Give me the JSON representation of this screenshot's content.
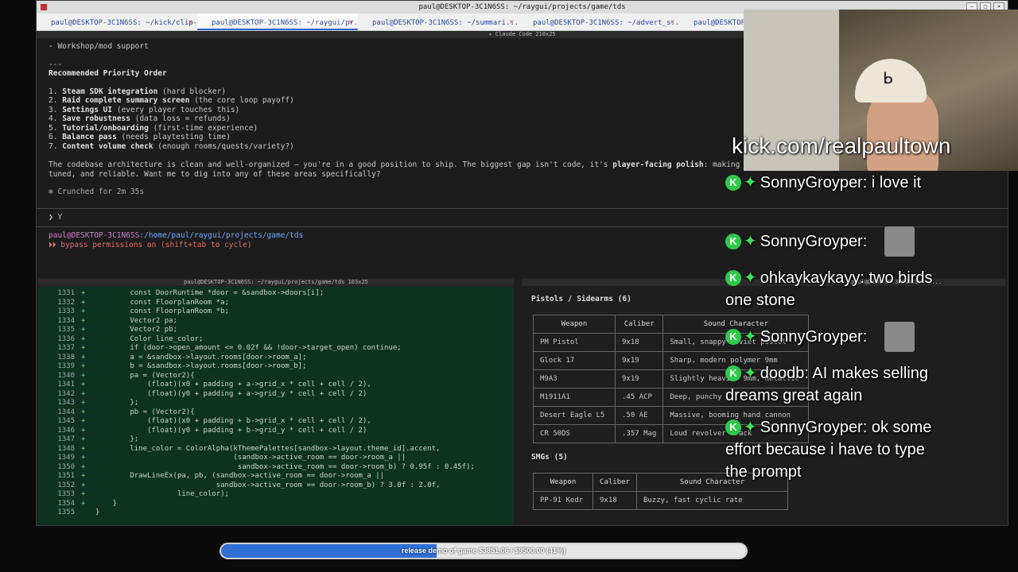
{
  "window": {
    "title": "paul@DESKTOP-3C1N6SS: ~/raygui/projects/game/tds",
    "tabs": [
      {
        "label": "paul@DESKTOP-3C1N6SS: ~/kick/clip-..."
      },
      {
        "label": "paul@DESKTOP-3C1N6SS: ~/raygui/pr..."
      },
      {
        "label": "paul@DESKTOP-3C1N6SS: ~/summari..."
      },
      {
        "label": "paul@DESKTOP-3C1N6SS: ~/advert_s..."
      },
      {
        "label": "paul@DESKTOP-3C1N6SS: ~..."
      }
    ],
    "active_tab": 1
  },
  "top_pane": {
    "header": "✳ Claude Code 210x25",
    "lines": {
      "l0": "- Workshop/mod support",
      "l1": "---",
      "heading": "Recommended Priority Order",
      "items": [
        {
          "num": "1.",
          "bold": "Steam SDK integration",
          "rest": " (hard blocker)"
        },
        {
          "num": "2.",
          "bold": "Raid complete summary screen",
          "rest": " (the core loop payoff)"
        },
        {
          "num": "3.",
          "bold": "Settings UI",
          "rest": " (every player touches this)"
        },
        {
          "num": "4.",
          "bold": "Save robustness",
          "rest": " (data loss = refunds)"
        },
        {
          "num": "5.",
          "bold": "Tutorial/onboarding",
          "rest": " (first-time experience)"
        },
        {
          "num": "6.",
          "bold": "Balance pass",
          "rest": " (needs playtesting time)"
        },
        {
          "num": "7.",
          "bold": "Content volume check",
          "rest": " (enough rooms/quests/variety?)"
        }
      ],
      "summary_a": "The codebase architecture is clean and well-organized — you're in a good position to ship. The biggest gap isn't code, it's ",
      "summary_bold": "player-facing polish",
      "summary_b": ": making",
      "summary_c": "tuned, and reliable. Want me to dig into any of these areas specifically?",
      "crunched": "✻ Crunched for 2m 35s",
      "prompt": "❯ Y",
      "cwd_user": "paul@DESKTOP-3C1N6SS",
      "cwd_path": ":/home/paul/raygui/projects/game/tds",
      "perm": "⏵⏵ bypass permissions on (shift+tab to cycle)"
    }
  },
  "left_pane": {
    "header": "paul@DESKTOP-3C1N6SS: ~/raygui/projects/game/tds 103x25",
    "code": [
      {
        "n": "1331",
        "p": "+",
        "t": "        const DoorRuntime *door = &sandbox->doors[i];"
      },
      {
        "n": "1332",
        "p": "+",
        "t": "        const FloorplanRoom *a;"
      },
      {
        "n": "1333",
        "p": "+",
        "t": "        const FloorplanRoom *b;"
      },
      {
        "n": "1334",
        "p": "+",
        "t": "        Vector2 pa;"
      },
      {
        "n": "1335",
        "p": "+",
        "t": "        Vector2 pb;"
      },
      {
        "n": "1336",
        "p": "+",
        "t": "        Color line_color;"
      },
      {
        "n": "1337",
        "p": "+",
        "t": "        if (door->open_amount <= 0.02f && !door->target_open) continue;"
      },
      {
        "n": "1338",
        "p": "+",
        "t": "        a = &sandbox->layout.rooms[door->room_a];"
      },
      {
        "n": "1339",
        "p": "+",
        "t": "        b = &sandbox->layout.rooms[door->room_b];"
      },
      {
        "n": "1340",
        "p": "+",
        "t": "        pa = (Vector2){"
      },
      {
        "n": "1341",
        "p": "+",
        "t": "            (float)(x0 + padding + a->grid_x * cell + cell / 2),"
      },
      {
        "n": "1342",
        "p": "+",
        "t": "            (float)(y0 + padding + a->grid_y * cell + cell / 2)"
      },
      {
        "n": "1343",
        "p": "+",
        "t": "        };"
      },
      {
        "n": "1344",
        "p": "+",
        "t": "        pb = (Vector2){"
      },
      {
        "n": "1345",
        "p": "+",
        "t": "            (float)(x0 + padding + b->grid_x * cell + cell / 2),"
      },
      {
        "n": "1346",
        "p": "+",
        "t": "            (float)(y0 + padding + b->grid_y * cell + cell / 2)"
      },
      {
        "n": "1347",
        "p": "+",
        "t": "        };"
      },
      {
        "n": "1348",
        "p": "+",
        "t": "        line_color = ColorAlpha(kThemePalettes[sandbox->layout.theme_id].accent,"
      },
      {
        "n": "1349",
        "p": "+",
        "t": "                                (sandbox->active_room == door->room_a ||"
      },
      {
        "n": "1350",
        "p": "+",
        "t": "                                 sandbox->active_room == door->room_b) ? 0.95f : 0.45f);"
      },
      {
        "n": "1351",
        "p": "+",
        "t": "        DrawLineEx(pa, pb, (sandbox->active_room == door->room_a ||"
      },
      {
        "n": "1352",
        "p": "+",
        "t": "                            sandbox->active_room == door->room_b) ? 3.0f : 2.0f,"
      },
      {
        "n": "1353",
        "p": "+",
        "t": "                   line_color);"
      },
      {
        "n": "1354",
        "p": "+",
        "t": "    }"
      },
      {
        "n": "1355",
        "p": " ",
        "t": "}"
      }
    ]
  },
  "right_pane": {
    "header": "paul@DESKTOP-3C1N6SS: ~/...",
    "pistols_title": "Pistols / Sidearms (6)",
    "headers": [
      "Weapon",
      "Caliber",
      "Sound Character"
    ],
    "pistols": [
      [
        "PM Pistol",
        "9x18",
        "Small, snappy Soviet pistol"
      ],
      [
        "Glock 17",
        "9x19",
        "Sharp, modern polymer 9mm"
      ],
      [
        "M9A3",
        "9x19",
        "Slightly heavier 9mm, metallic"
      ],
      [
        "M1911A1",
        ".45 ACP",
        "Deep, punchy"
      ],
      [
        "Desert Eagle L5",
        ".50 AE",
        "Massive, booming hand cannon"
      ],
      [
        "CR 50DS",
        ".357 Mag",
        "Loud revolver crack"
      ]
    ],
    "smg_title": "SMGs (5)",
    "smgs": [
      [
        "PP-91 Kedr",
        "9x18",
        "Buzzy, fast cyclic rate"
      ]
    ]
  },
  "stream": {
    "kick_url": "kick.com/realpaultown",
    "chat": [
      {
        "user": "SonnyGroyper:",
        "text": "i love it"
      },
      {
        "user": "SonnyGroyper:",
        "text": ""
      },
      {
        "user": "ohkaykaykayy:",
        "text": "two birds one stone"
      },
      {
        "user": "SonnyGroyper:",
        "text": ""
      },
      {
        "user": "doodb:",
        "text": "AI makes selling dreams great again"
      },
      {
        "user": "SonnyGroyper:",
        "text": "ok some effort because i have to type the prompt"
      }
    ],
    "goal": {
      "label": "release demo of game $3851.06 / $9500.00 (41%)",
      "progress": 0.41
    }
  },
  "colors": {
    "kick_green": "#2ec84a",
    "diff_bg": "#0d3320",
    "goal_fill": "#2f6fd6"
  }
}
